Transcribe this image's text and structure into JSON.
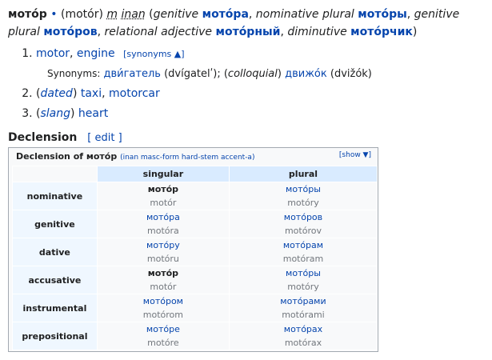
{
  "headword": {
    "word": "мото́р",
    "bullet": "•",
    "translit": "(motór)",
    "gender": "m",
    "animacy": "inan",
    "infl_open": "(",
    "genitive_label": "genitive",
    "genitive_form": "мото́ра",
    "nom_pl_label": "nominative plural",
    "nom_pl_form": "мото́ры",
    "gen_pl_label": "genitive plural",
    "gen_pl_form": "мото́ров",
    "rel_adj_label": "relational adjective",
    "rel_adj_form": "мото́рный",
    "dim_label": "diminutive",
    "dim_form": "мото́рчик",
    "infl_close": ")"
  },
  "senses": [
    {
      "num": "1.",
      "links": [
        "motor",
        "engine"
      ],
      "synonyms_toggle": "[synonyms ▲]",
      "synonyms": {
        "label": "Synonyms:",
        "syn1": "дви́гатель",
        "syn1_tr": "(dvígatelʹ)",
        "qualifier": "colloquial",
        "syn2": "движо́к",
        "syn2_tr": "(dvižók)"
      }
    },
    {
      "num": "2.",
      "qualifier": "dated",
      "links": [
        "taxi",
        "motorcar"
      ]
    },
    {
      "num": "3.",
      "qualifier": "slang",
      "links": [
        "heart"
      ]
    }
  ],
  "declension": {
    "heading": "Declension",
    "edit": "[ edit ]",
    "table_title": "Declension of мото́р",
    "table_subtitle": "(inan masc-form hard-stem accent-a)",
    "show": "[show ▼]",
    "columns": [
      "singular",
      "plural"
    ],
    "rows": [
      {
        "case": "nominative",
        "sg": "мото́р",
        "sg_tr": "motór",
        "pl": "мото́ры",
        "pl_tr": "motóry"
      },
      {
        "case": "genitive",
        "sg": "мото́ра",
        "sg_tr": "motóra",
        "pl": "мото́ров",
        "pl_tr": "motórov"
      },
      {
        "case": "dative",
        "sg": "мото́ру",
        "sg_tr": "motóru",
        "pl": "мото́рам",
        "pl_tr": "motóram"
      },
      {
        "case": "accusative",
        "sg": "мото́р",
        "sg_tr": "motór",
        "pl": "мото́ры",
        "pl_tr": "motóry"
      },
      {
        "case": "instrumental",
        "sg": "мото́ром",
        "sg_tr": "motórom",
        "pl": "мото́рами",
        "pl_tr": "motórami"
      },
      {
        "case": "prepositional",
        "sg": "мото́ре",
        "sg_tr": "motóre",
        "pl": "мото́рах",
        "pl_tr": "motórax"
      }
    ]
  }
}
